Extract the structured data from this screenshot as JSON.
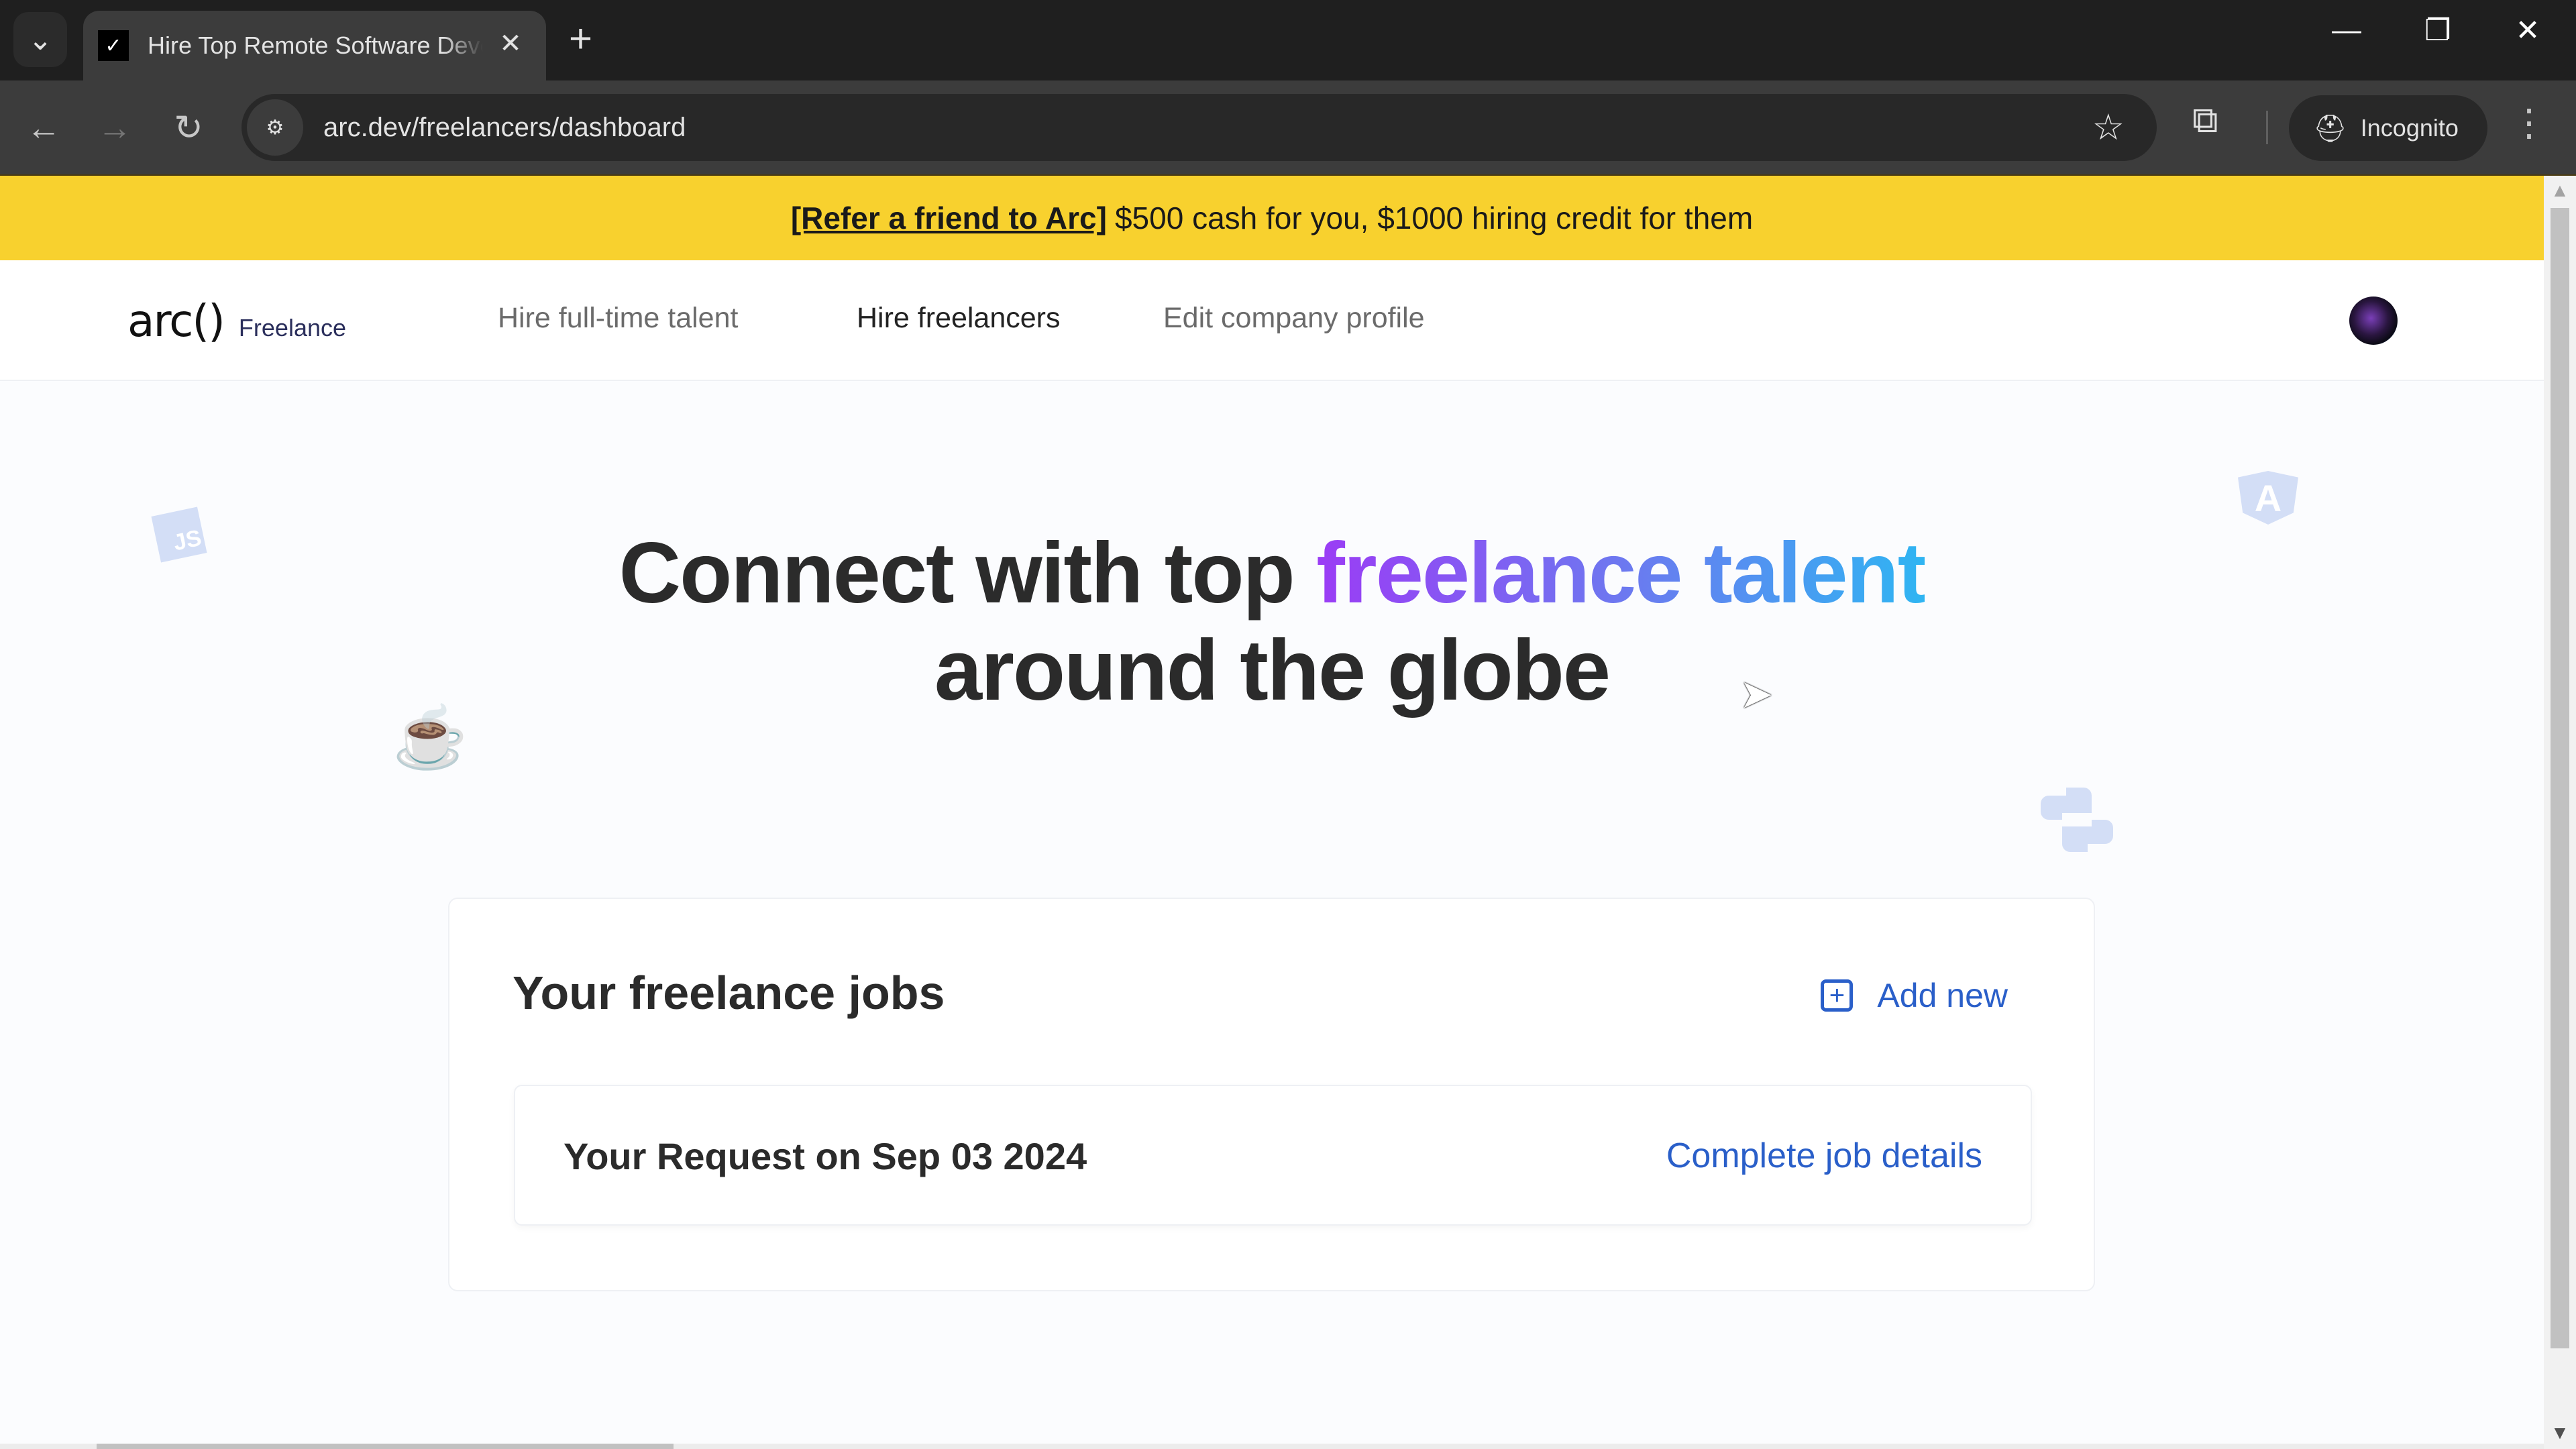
{
  "browser": {
    "tab_title": "Hire Top Remote Software Developers",
    "tab_favicon": "arc-checkmark-icon",
    "url": "arc.dev/freelancers/dashboard",
    "incognito_label": "Incognito",
    "icons": {
      "tab_search": "⌄",
      "tab_close": "✕",
      "new_tab": "+",
      "minimize": "—",
      "restore": "❐",
      "close": "✕",
      "back": "←",
      "forward": "→",
      "reload": "↻",
      "site_info": "⚙",
      "bookmark": "☆",
      "extensions": "⧉",
      "incognito": "🕵",
      "menu": "⋮"
    }
  },
  "banner": {
    "link_text": "[Refer a friend to Arc]",
    "message": "$500 cash for you, $1000 hiring credit for them",
    "background": "#f8d12e"
  },
  "nav": {
    "logo_mark": "arc()",
    "logo_sub": "Freelance",
    "links": [
      {
        "label": "Hire full-time talent",
        "active": false
      },
      {
        "label": "Hire freelancers",
        "active": true
      },
      {
        "label": "Edit company profile",
        "active": false
      }
    ]
  },
  "hero": {
    "line1_plain": "Connect with top ",
    "line1_highlight": "freelance talent",
    "line2": "around the globe",
    "gradient_start": "#9b3cf5",
    "gradient_end": "#2fb5f2"
  },
  "decorations": {
    "js": "JS",
    "angular": "A",
    "java": "☕",
    "python": "🐍"
  },
  "jobs": {
    "title": "Your freelance jobs",
    "add_new_label": "Add new",
    "add_icon": "+",
    "accent": "#2a5fc9",
    "items": [
      {
        "title": "Your Request on Sep 03 2024",
        "action": "Complete job details"
      }
    ]
  }
}
